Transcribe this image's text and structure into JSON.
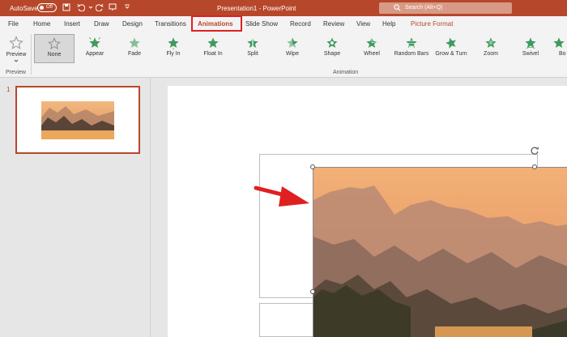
{
  "titlebar": {
    "autosave_label": "AutoSave",
    "autosave_state": "Off",
    "document_title": "Presentation1  -  PowerPoint",
    "search_placeholder": "Search (Alt+Q)",
    "accent_color": "#b7472a"
  },
  "quick_access": [
    {
      "icon": "save-icon"
    },
    {
      "icon": "undo-icon"
    },
    {
      "icon": "redo-icon"
    },
    {
      "icon": "present-icon"
    },
    {
      "icon": "customize-icon"
    }
  ],
  "tabs": [
    {
      "label": "File"
    },
    {
      "label": "Home"
    },
    {
      "label": "Insert"
    },
    {
      "label": "Draw"
    },
    {
      "label": "Design"
    },
    {
      "label": "Transitions"
    },
    {
      "label": "Animations",
      "active": true
    },
    {
      "label": "Slide Show"
    },
    {
      "label": "Record"
    },
    {
      "label": "Review"
    },
    {
      "label": "View"
    },
    {
      "label": "Help"
    },
    {
      "label": "Picture Format"
    }
  ],
  "ribbon": {
    "preview_label": "Preview",
    "preview_group_label": "Preview",
    "animation_group_label": "Animation",
    "animations": [
      {
        "label": "None",
        "selected": true,
        "icon": "star-outline-icon"
      },
      {
        "label": "Appear",
        "icon": "appear-star-icon"
      },
      {
        "label": "Fade",
        "icon": "fade-star-icon"
      },
      {
        "label": "Fly In",
        "icon": "fly-in-star-icon"
      },
      {
        "label": "Float In",
        "icon": "float-in-star-icon"
      },
      {
        "label": "Split",
        "icon": "split-star-icon"
      },
      {
        "label": "Wipe",
        "icon": "wipe-star-icon"
      },
      {
        "label": "Shape",
        "icon": "shape-star-icon"
      },
      {
        "label": "Wheel",
        "icon": "wheel-star-icon"
      },
      {
        "label": "Random Bars",
        "icon": "random-bars-star-icon"
      },
      {
        "label": "Grow & Turn",
        "icon": "grow-turn-star-icon"
      },
      {
        "label": "Zoom",
        "icon": "zoom-star-icon"
      },
      {
        "label": "Swivel",
        "icon": "swivel-star-icon"
      },
      {
        "label": "Bo",
        "icon": "bounce-star-icon"
      }
    ]
  },
  "thumbnails": [
    {
      "number": "1"
    }
  ],
  "colors": {
    "animation_star": "#3e9b5d",
    "annotation_red": "#e02020"
  }
}
